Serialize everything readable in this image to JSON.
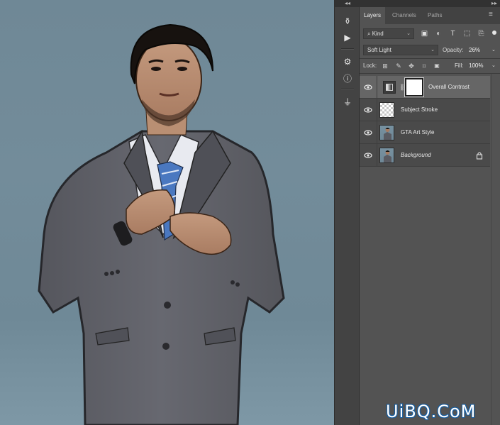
{
  "panel_strip": {
    "collapse_left": "◂◂",
    "collapse_right": "▸▸",
    "tools": [
      {
        "icon": "history-brush-icon",
        "glyph": "⚱"
      },
      {
        "icon": "play-action-icon",
        "glyph": "▶"
      },
      {
        "icon": "channel-mixer-icon",
        "glyph": "⚙"
      },
      {
        "icon": "info-icon",
        "glyph": "ⓘ"
      },
      {
        "icon": "clone-source-icon",
        "glyph": "⏚"
      }
    ]
  },
  "layers_panel": {
    "tabs": [
      {
        "label": "Layers",
        "active": true
      },
      {
        "label": "Channels",
        "active": false
      },
      {
        "label": "Paths",
        "active": false
      }
    ],
    "filter": {
      "search_glyph": "⌕",
      "kind_label": "Kind"
    },
    "filter_icons": [
      "image-filter-icon",
      "adjustment-filter-icon",
      "type-filter-icon",
      "shape-filter-icon",
      "smart-object-filter-icon"
    ],
    "filter_glyphs": [
      "▣",
      "◐",
      "T",
      "⬚",
      "⎘"
    ],
    "blend_mode": "Soft Light",
    "opacity_label": "Opacity:",
    "opacity_value": "26%",
    "lock_label": "Lock:",
    "lock_icons": [
      "lock-transparent-icon",
      "lock-image-icon",
      "lock-position-icon",
      "lock-artboard-icon",
      "lock-all-icon"
    ],
    "lock_glyphs": [
      "⊞",
      "✎",
      "✥",
      "⌗",
      "🔒"
    ],
    "fill_label": "Fill:",
    "fill_value": "100%",
    "layers": [
      {
        "name": "Overall Contrast",
        "type": "adjustment",
        "selected": true,
        "italic": false,
        "locked": false
      },
      {
        "name": "Subject Stroke",
        "type": "transparent",
        "selected": false,
        "italic": false,
        "locked": false
      },
      {
        "name": "GTA Art Style",
        "type": "photo",
        "selected": false,
        "italic": false,
        "locked": false
      },
      {
        "name": "Background",
        "type": "photo",
        "selected": false,
        "italic": true,
        "locked": true
      }
    ]
  },
  "watermark": "UiBQ.CoM",
  "colors": {
    "panel_bg": "#535353",
    "selected_row": "#666666",
    "canvas_bg": "#738c9a",
    "suit": "#5e5f66"
  }
}
